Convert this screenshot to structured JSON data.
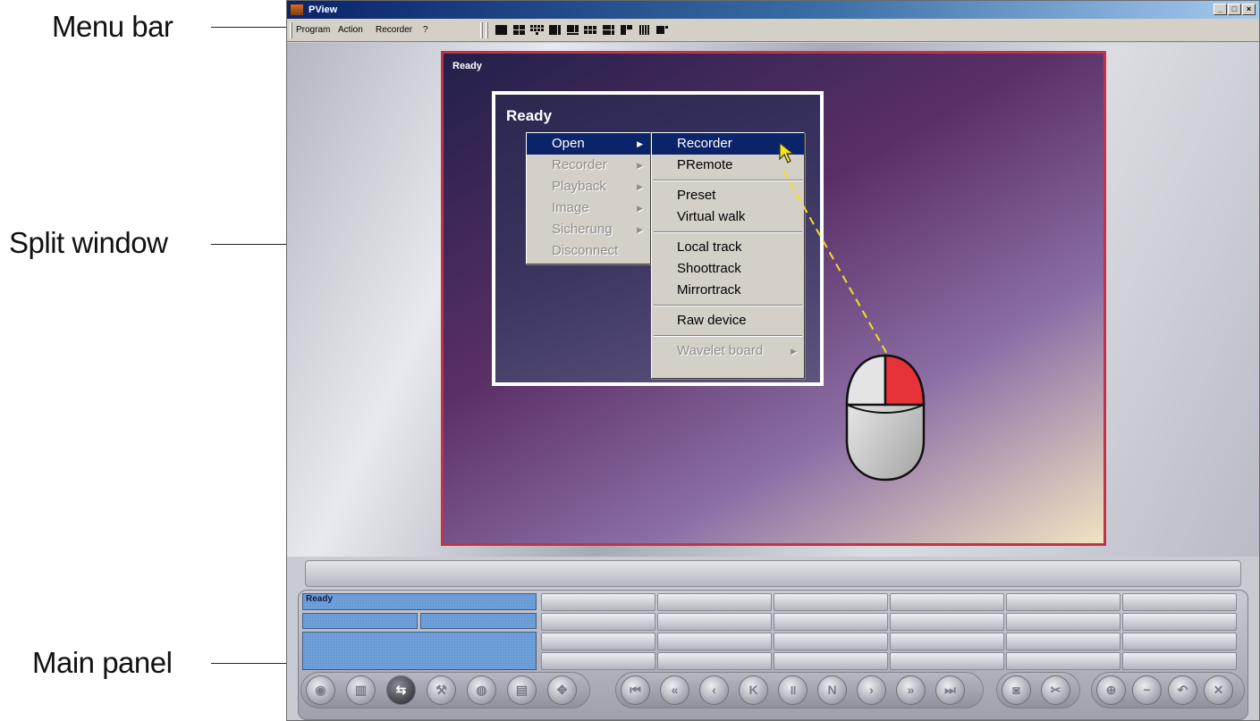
{
  "callouts": {
    "menu_bar": "Menu bar",
    "split_window": "Split window",
    "main_panel": "Main panel"
  },
  "window": {
    "title": "PView",
    "controls": [
      "_",
      "□",
      "×"
    ]
  },
  "menubar": {
    "items": [
      "Program",
      "Action",
      "Recorder",
      "?"
    ],
    "layout_buttons": [
      "layout-1",
      "layout-4",
      "layout-9",
      "layout-1-3",
      "layout-1-5",
      "layout-3x3",
      "layout-2x2b",
      "layout-3b",
      "layout-4x4",
      "layout-next"
    ]
  },
  "split_window": {
    "status": "Ready"
  },
  "context_menu": {
    "status": "Ready",
    "main_items": [
      {
        "label": "Open",
        "state": "highlighted",
        "submenu": true
      },
      {
        "label": "Recorder",
        "state": "disabled",
        "submenu": true
      },
      {
        "label": "Playback",
        "state": "disabled",
        "submenu": true
      },
      {
        "label": "Image",
        "state": "disabled",
        "submenu": true
      },
      {
        "label": "Sicherung",
        "state": "disabled",
        "submenu": true
      },
      {
        "label": "Disconnect",
        "state": "disabled",
        "submenu": false
      }
    ],
    "open_submenu": {
      "groups": [
        [
          {
            "label": "Recorder",
            "state": "highlighted"
          },
          {
            "label": "PRemote",
            "state": "normal"
          }
        ],
        [
          {
            "label": "Preset",
            "state": "normal"
          },
          {
            "label": "Virtual walk",
            "state": "normal"
          }
        ],
        [
          {
            "label": "Local track",
            "state": "normal"
          },
          {
            "label": "Shoottrack",
            "state": "normal"
          },
          {
            "label": "Mirrortrack",
            "state": "normal"
          }
        ],
        [
          {
            "label": "Raw device",
            "state": "normal"
          }
        ],
        [
          {
            "label": "Wavelet board",
            "state": "disabled",
            "submenu": true
          }
        ]
      ]
    }
  },
  "main_panel": {
    "status_display": "Ready",
    "left_buttons": [
      "eye-icon",
      "film-icon",
      "connect-icon",
      "tools-icon",
      "globe-icon",
      "save-icon",
      "settings-icon"
    ],
    "playback_buttons": [
      "skip-start-icon",
      "rewind-icon",
      "step-back-icon",
      "prev-mark-icon",
      "pause-icon",
      "next-mark-icon",
      "play-icon",
      "fast-forward-icon",
      "skip-end-icon"
    ],
    "snapshot_buttons": [
      "camera-icon",
      "scissors-icon"
    ],
    "right_buttons": [
      "zoom-icon",
      "minus-icon",
      "undo-icon",
      "close-icon"
    ]
  },
  "colors": {
    "split_border": "#c2334a",
    "menu_highlight": "#0a246a",
    "lcd": "#6f9fd8",
    "mouse_button_pressed": "#e8323a",
    "pointer_line": "#f0e020"
  }
}
